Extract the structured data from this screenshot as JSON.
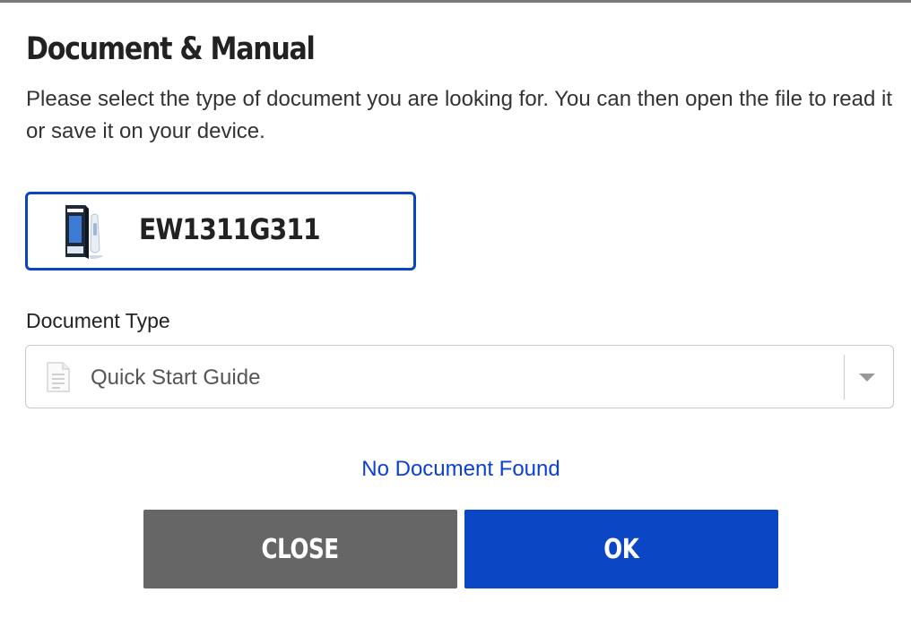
{
  "dialog": {
    "title": "Document & Manual",
    "description": "Please select the type of document you are looking for. You can then open the file to read it or save it on your device."
  },
  "product": {
    "model": "EW1311G311",
    "thumbnail_icon": "product-box-icon"
  },
  "document_type": {
    "label": "Document Type",
    "selected": "Quick Start Guide",
    "icon": "document-icon"
  },
  "status": {
    "message": "No Document Found"
  },
  "buttons": {
    "close_label": "CLOSE",
    "ok_label": "OK"
  },
  "colors": {
    "accent": "#0b47c4",
    "close_button": "#666666",
    "status_link": "#0b3fd8"
  }
}
